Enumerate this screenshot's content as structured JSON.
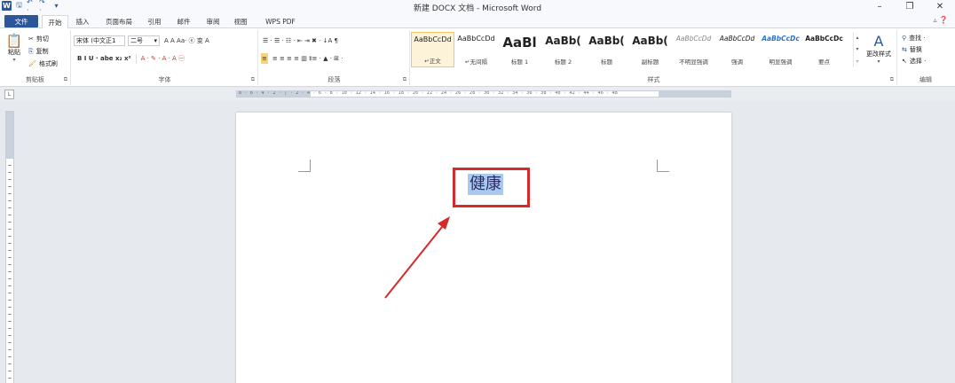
{
  "window": {
    "title": "新建 DOCX 文档 - Microsoft Word",
    "qat": {
      "logo": "W",
      "save": "🖫",
      "undo": "↶ ·",
      "redo": "↷ ·",
      "more": "▾"
    },
    "controls": {
      "minimize": "–",
      "restore": "❐",
      "close": "✕"
    }
  },
  "tabs": {
    "file": "文件",
    "home": "开始",
    "insert": "插入",
    "layout": "页面布局",
    "references": "引用",
    "mailings": "邮件",
    "review": "审阅",
    "view": "视图",
    "wps": "WPS PDF",
    "right_icons": "▵  ❓"
  },
  "clipboard": {
    "label": "剪贴板",
    "paste": "粘贴",
    "cut": "剪切",
    "copy": "复制",
    "format_painter": "格式刷"
  },
  "font": {
    "label": "字体",
    "font_name": "宋体 (中文正1",
    "font_size": "二号",
    "row1_tools": "A A  Aa·  ⓔ 变  A",
    "row2_tools": "B  I  U ·  abe  x₂  x²",
    "row2_color_tools": "A · ✎ · A · A ㊀"
  },
  "paragraph": {
    "label": "段落",
    "row1_tools": "☰ · ☰ · ☷ ·   ⇤ ⇥   ✖ ·   ↓A  ¶",
    "row2_tools": "≡ ≡ ≡ ≡ ▥   ‡≡ ·   ▲ · ⊞ ·"
  },
  "styles": {
    "label": "样式",
    "change_styles": "更改样式",
    "items": [
      {
        "sample": "AaBbCcDd",
        "name": "↵正文"
      },
      {
        "sample": "AaBbCcDd",
        "name": "↵无间隔"
      },
      {
        "sample": "AaBl",
        "name": "标题 1"
      },
      {
        "sample": "AaBb(",
        "name": "标题 2"
      },
      {
        "sample": "AaBb(",
        "name": "标题"
      },
      {
        "sample": "AaBb(",
        "name": "副标题"
      },
      {
        "sample": "AaBbCcDd",
        "name": "不明显强调"
      },
      {
        "sample": "AaBbCcDd",
        "name": "强调"
      },
      {
        "sample": "AaBbCcDc",
        "name": "明显强调"
      },
      {
        "sample": "AaBbCcDc",
        "name": "要点"
      }
    ]
  },
  "editing": {
    "label": "编辑",
    "find": "查找 ·",
    "replace": "替换",
    "select": "选择 ·"
  },
  "ruler": {
    "corner": "L",
    "scale": "8 · 6 · 4 · 2 · | · 2 · 4 · 6 · 8 · 10 · 12 · 14 · 16 · 18 · 20 · 22 · 24 · 26 · 28 · 30 · 32 · 34 · 36 · 38 · 40 · 42 · 44 · 46 · 48"
  },
  "document": {
    "text": "健康"
  },
  "colors": {
    "accent": "#2b579a",
    "selection": "#a9c9ee",
    "annotation": "#d42a2a"
  }
}
